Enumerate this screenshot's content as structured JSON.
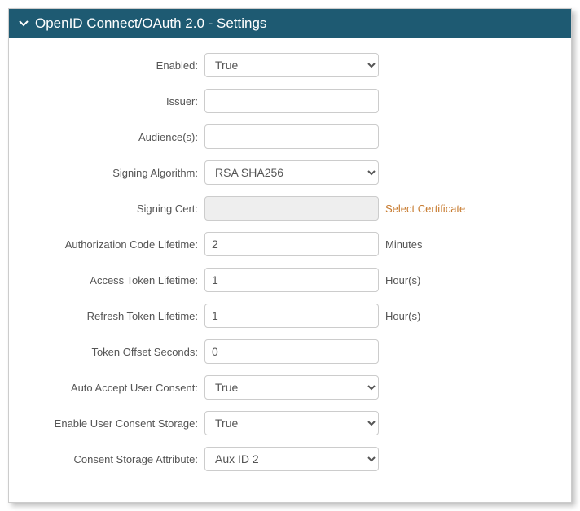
{
  "header": {
    "title": "OpenID Connect/OAuth 2.0 - Settings"
  },
  "form": {
    "enabled": {
      "label": "Enabled:",
      "value": "True"
    },
    "issuer": {
      "label": "Issuer:",
      "value": ""
    },
    "audiences": {
      "label": "Audience(s):",
      "value": ""
    },
    "signing_algorithm": {
      "label": "Signing Algorithm:",
      "value": "RSA SHA256"
    },
    "signing_cert": {
      "label": "Signing Cert:",
      "value": "",
      "action": "Select Certificate"
    },
    "auth_code_lifetime": {
      "label": "Authorization Code Lifetime:",
      "value": "2",
      "unit": "Minutes"
    },
    "access_token_lifetime": {
      "label": "Access Token Lifetime:",
      "value": "1",
      "unit": "Hour(s)"
    },
    "refresh_token_lifetime": {
      "label": "Refresh Token Lifetime:",
      "value": "1",
      "unit": "Hour(s)"
    },
    "token_offset_seconds": {
      "label": "Token Offset Seconds:",
      "value": "0"
    },
    "auto_accept_consent": {
      "label": "Auto Accept User Consent:",
      "value": "True"
    },
    "enable_consent_storage": {
      "label": "Enable User Consent Storage:",
      "value": "True"
    },
    "consent_storage_attribute": {
      "label": "Consent Storage Attribute:",
      "value": "Aux ID 2"
    }
  }
}
